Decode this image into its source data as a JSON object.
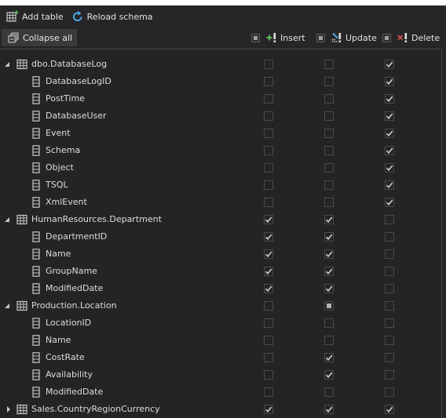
{
  "toolbar": {
    "add_table": {
      "label": "Add table",
      "icon": "add-table-icon"
    },
    "reload_schema": {
      "label": "Reload schema",
      "icon": "reload-icon"
    }
  },
  "subbar": {
    "collapse_all": {
      "label": "Collapse all",
      "icon": "collapse-all-icon"
    },
    "columns": [
      {
        "key": "insert",
        "label": "Insert",
        "icon": "insert-icon",
        "header_state": "partial"
      },
      {
        "key": "update",
        "label": "Update",
        "icon": "update-icon",
        "header_state": "partial"
      },
      {
        "key": "delete",
        "label": "Delete",
        "icon": "delete-icon",
        "header_state": "partial"
      }
    ]
  },
  "colors": {
    "background": "#242426",
    "toolbar": "#262628",
    "text": "#dcdcdc",
    "insert_accent": "#5cb85c",
    "update_accent": "#4aa3df",
    "delete_accent": "#d9534f",
    "checkmark": "#c8c8c8"
  },
  "tree": [
    {
      "type": "table",
      "name": "dbo.DatabaseLog",
      "expanded": true,
      "insert": "unchecked",
      "update": "unchecked",
      "delete": "checked"
    },
    {
      "type": "column",
      "name": "DatabaseLogID",
      "insert": "unchecked",
      "update": "unchecked",
      "delete": "checked"
    },
    {
      "type": "column",
      "name": "PostTime",
      "insert": "unchecked",
      "update": "unchecked",
      "delete": "checked"
    },
    {
      "type": "column",
      "name": "DatabaseUser",
      "insert": "unchecked",
      "update": "unchecked",
      "delete": "checked"
    },
    {
      "type": "column",
      "name": "Event",
      "insert": "unchecked",
      "update": "unchecked",
      "delete": "checked"
    },
    {
      "type": "column",
      "name": "Schema",
      "insert": "unchecked",
      "update": "unchecked",
      "delete": "checked"
    },
    {
      "type": "column",
      "name": "Object",
      "insert": "unchecked",
      "update": "unchecked",
      "delete": "checked"
    },
    {
      "type": "column",
      "name": "TSQL",
      "insert": "unchecked",
      "update": "unchecked",
      "delete": "checked"
    },
    {
      "type": "column",
      "name": "XmlEvent",
      "insert": "unchecked",
      "update": "unchecked",
      "delete": "checked"
    },
    {
      "type": "table",
      "name": "HumanResources.Department",
      "expanded": true,
      "insert": "checked",
      "update": "checked",
      "delete": "unchecked"
    },
    {
      "type": "column",
      "name": "DepartmentID",
      "insert": "checked",
      "update": "checked",
      "delete": "unchecked"
    },
    {
      "type": "column",
      "name": "Name",
      "insert": "checked",
      "update": "checked",
      "delete": "unchecked"
    },
    {
      "type": "column",
      "name": "GroupName",
      "insert": "checked",
      "update": "checked",
      "delete": "unchecked"
    },
    {
      "type": "column",
      "name": "ModifiedDate",
      "insert": "checked",
      "update": "checked",
      "delete": "unchecked"
    },
    {
      "type": "table",
      "name": "Production.Location",
      "expanded": true,
      "insert": "unchecked",
      "update": "partial",
      "delete": "unchecked"
    },
    {
      "type": "column",
      "name": "LocationID",
      "insert": "unchecked",
      "update": "unchecked",
      "delete": "unchecked"
    },
    {
      "type": "column",
      "name": "Name",
      "insert": "unchecked",
      "update": "unchecked",
      "delete": "unchecked"
    },
    {
      "type": "column",
      "name": "CostRate",
      "insert": "unchecked",
      "update": "checked",
      "delete": "unchecked"
    },
    {
      "type": "column",
      "name": "Availability",
      "insert": "unchecked",
      "update": "checked",
      "delete": "unchecked"
    },
    {
      "type": "column",
      "name": "ModifiedDate",
      "insert": "unchecked",
      "update": "unchecked",
      "delete": "unchecked"
    },
    {
      "type": "table",
      "name": "Sales.CountryRegionCurrency",
      "expanded": false,
      "insert": "checked",
      "update": "checked",
      "delete": "checked"
    }
  ]
}
